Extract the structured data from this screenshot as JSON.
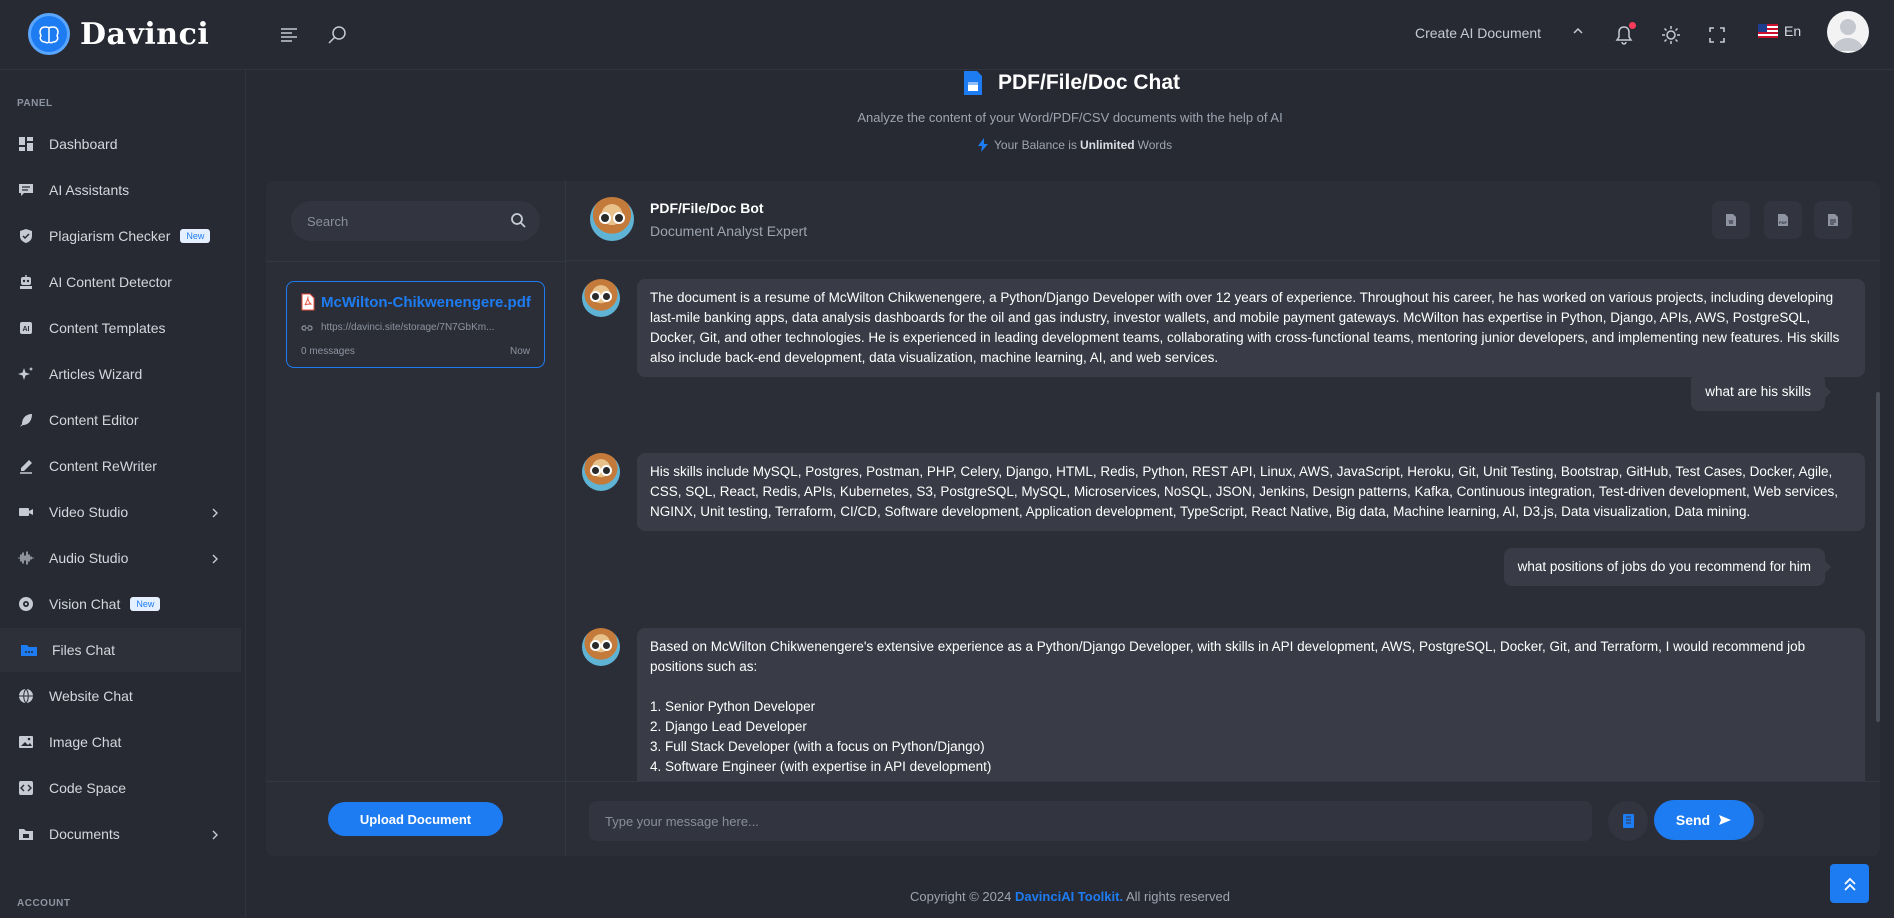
{
  "brand": {
    "name": "Davinci"
  },
  "header": {
    "create_doc": "Create AI Document",
    "lang": "En"
  },
  "sidebar": {
    "section_panel": "PANEL",
    "section_account": "ACCOUNT",
    "items": [
      {
        "label": "Dashboard",
        "icon": "dashboard-icon"
      },
      {
        "label": "AI Assistants",
        "icon": "chat-icon"
      },
      {
        "label": "Plagiarism Checker",
        "icon": "shield-icon",
        "badge": "New"
      },
      {
        "label": "AI Content Detector",
        "icon": "detector-icon"
      },
      {
        "label": "Content Templates",
        "icon": "ai-template-icon"
      },
      {
        "label": "Articles Wizard",
        "icon": "sparkle-icon"
      },
      {
        "label": "Content Editor",
        "icon": "feather-icon"
      },
      {
        "label": "Content ReWriter",
        "icon": "pen-icon"
      },
      {
        "label": "Video Studio",
        "icon": "video-icon"
      },
      {
        "label": "Audio Studio",
        "icon": "audio-wave-icon"
      },
      {
        "label": "Vision Chat",
        "icon": "vision-icon",
        "badge": "New"
      },
      {
        "label": "Files Chat",
        "icon": "folder-icon"
      },
      {
        "label": "Website Chat",
        "icon": "globe-icon"
      },
      {
        "label": "Image Chat",
        "icon": "image-icon"
      },
      {
        "label": "Code Space",
        "icon": "code-icon"
      },
      {
        "label": "Documents",
        "icon": "documents-icon"
      }
    ]
  },
  "page": {
    "title": "PDF/File/Doc Chat",
    "subtitle": "Analyze the content of your Word/PDF/CSV documents with the help of AI",
    "balance_prefix": "Your Balance is",
    "balance_value": "Unlimited",
    "balance_suffix": "Words"
  },
  "files": {
    "search_placeholder": "Search",
    "items": [
      {
        "name": "McWilton-Chikwenengere.pdf",
        "url": "https://davinci.site/storage/7N7GbKm...",
        "messages": "0 messages",
        "time": "Now"
      }
    ],
    "upload_label": "Upload Document"
  },
  "chat": {
    "bot_name": "PDF/File/Doc Bot",
    "bot_role": "Document Analyst Expert",
    "messages": [
      {
        "role": "bot",
        "text": "The document is a resume of McWilton Chikwenengere, a Python/Django Developer with over 12 years of experience. Throughout his career, he has worked on various projects, including developing last-mile banking apps, data analysis dashboards for the oil and gas industry, investor wallets, and mobile payment gateways. McWilton has expertise in Python, Django, APIs, AWS, PostgreSQL, Docker, Git, and other technologies. He is experienced in leading development teams, collaborating with cross-functional teams, mentoring junior developers, and implementing new features. His skills also include back-end development, data visualization, machine learning, AI, and web services."
      },
      {
        "role": "user",
        "text": "what are his skills"
      },
      {
        "role": "bot",
        "text": "His skills include MySQL, Postgres, Postman, PHP, Celery, Django, HTML, Redis, Python, REST API, Linux, AWS, JavaScript, Heroku, Git, Unit Testing, Bootstrap, GitHub, Test Cases, Docker, Agile, CSS, SQL, React, Redis, APIs, Kubernetes, S3, PostgreSQL, MySQL, Microservices, NoSQL, JSON, Jenkins, Design patterns, Kafka, Continuous integration, Test-driven development, Web services, NGINX, Unit testing, Terraform, CI/CD, Software development, Application development, TypeScript, React Native, Big data, Machine learning, AI, D3.js, Data visualization, Data mining."
      },
      {
        "role": "user",
        "text": "what positions of jobs do you recommend for him"
      },
      {
        "role": "bot",
        "text": "Based on McWilton Chikwenengere's extensive experience as a Python/Django Developer, with skills in API development, AWS, PostgreSQL, Docker, Git, and Terraform, I would recommend job positions such as:",
        "list": [
          "1. Senior Python Developer",
          "2. Django Lead Developer",
          "3. Full Stack Developer (with a focus on Python/Django)",
          "4. Software Engineer (with expertise in API development)"
        ]
      }
    ],
    "input_placeholder": "Type your message here...",
    "send_label": "Send"
  },
  "footer": {
    "prefix": "Copyright © 2024",
    "link": "DavinciAI Toolkit.",
    "suffix": "All rights reserved"
  },
  "colors": {
    "accent": "#1e7cf2",
    "background": "#272a33",
    "card": "#2b2e37",
    "bubble": "#393c46"
  }
}
